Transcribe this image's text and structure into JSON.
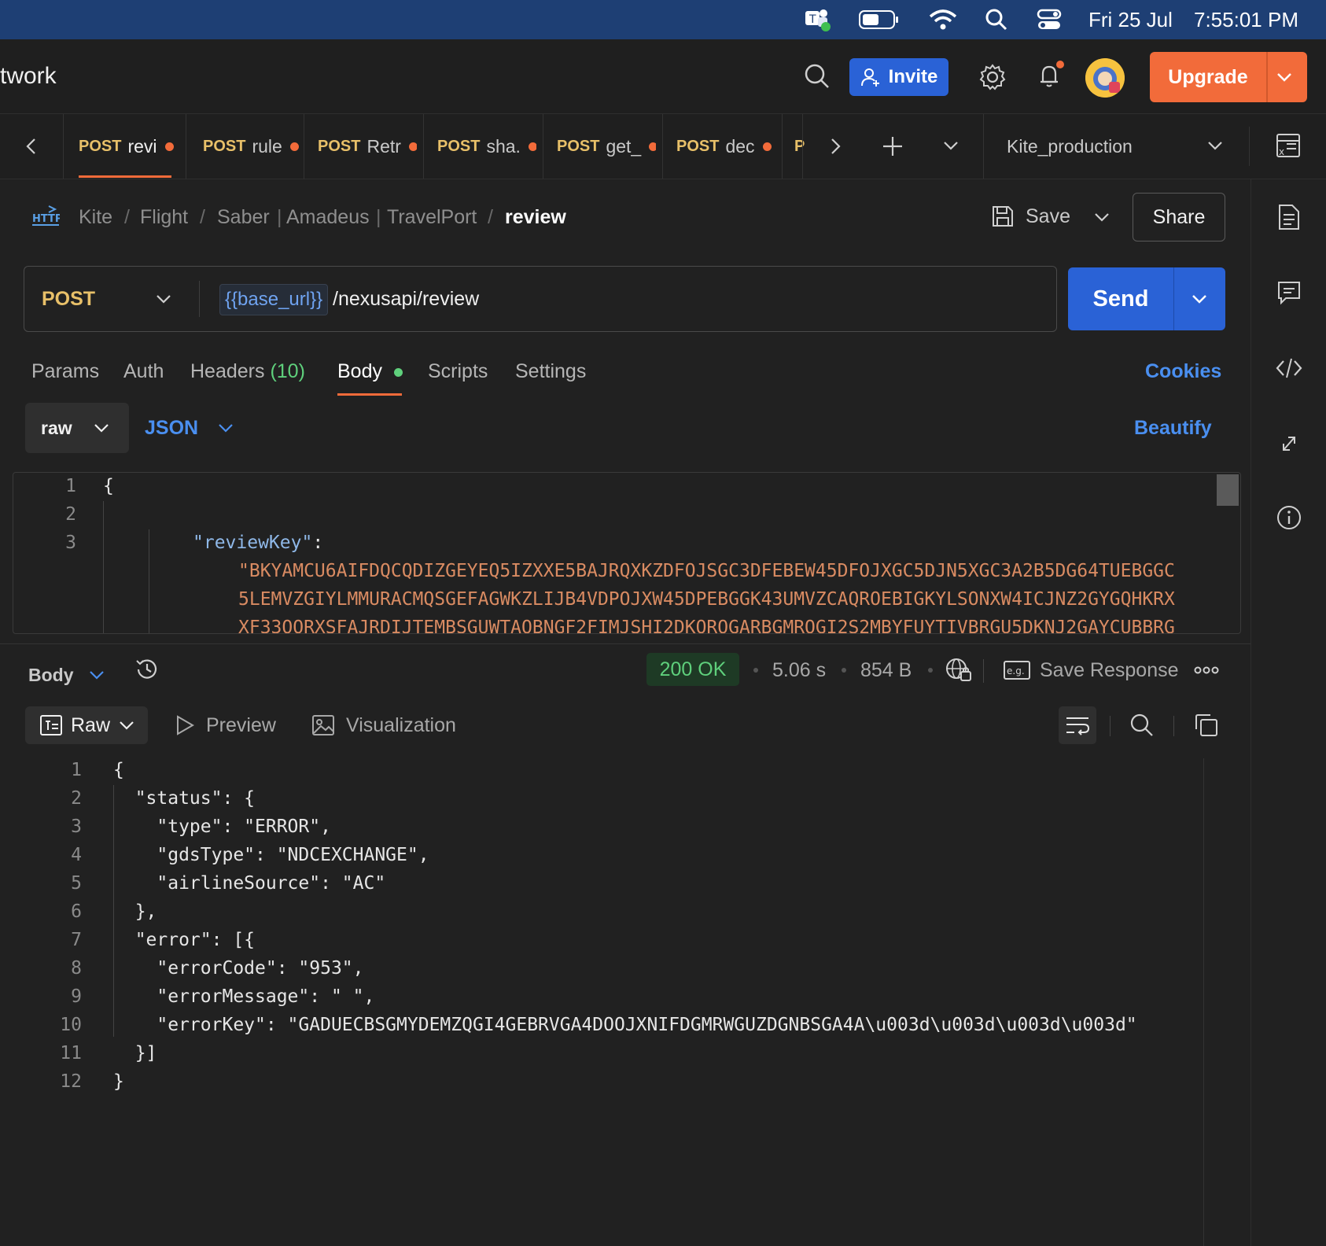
{
  "menubar": {
    "date": "Fri 25 Jul",
    "time": "7:55:01 PM"
  },
  "header": {
    "workspace_title": "twork",
    "invite_label": "Invite",
    "upgrade_label": "Upgrade"
  },
  "tabs": [
    {
      "method": "POST",
      "name": "revi"
    },
    {
      "method": "POST",
      "name": "rule"
    },
    {
      "method": "POST",
      "name": "Retr"
    },
    {
      "method": "POST",
      "name": "sha."
    },
    {
      "method": "POST",
      "name": "get_"
    },
    {
      "method": "POST",
      "name": "dec"
    },
    {
      "method": "P",
      "name": ""
    }
  ],
  "environment": "Kite_production",
  "breadcrumb": {
    "badge": "HTTP",
    "items": [
      "Kite",
      "/",
      "Flight",
      "/",
      "Saber",
      "|",
      "Amadeus",
      "|",
      "TravelPort",
      "/"
    ],
    "current": "review"
  },
  "actions": {
    "save_label": "Save",
    "share_label": "Share"
  },
  "request": {
    "method": "POST",
    "url_variable": "{{base_url}}",
    "url_path": "/nexusapi/review",
    "send_label": "Send"
  },
  "request_tabs": {
    "params": "Params",
    "auth": "Auth",
    "headers": "Headers",
    "headers_count": "(10)",
    "body": "Body",
    "scripts": "Scripts",
    "settings": "Settings",
    "cookies": "Cookies"
  },
  "body_toolbar": {
    "mode": "raw",
    "format": "JSON",
    "beautify": "Beautify"
  },
  "request_body": {
    "line_numbers": [
      "1",
      "2",
      "3"
    ],
    "line1": "{",
    "key": "\"reviewKey\"",
    "colon": ":",
    "value_lines": [
      "\"BKYAMCU6AIFDQCQDIZGEYEQ5IZXXE5BAJRQXKZDFOJSGC3DFEBEW45DFOJXGC5DJN5XGC3A2B5DG64TUEBGGC",
      "5LEMVZGIYLMMURACMQSGEFAGWKZLIJB4VDPOJXW45DPEBGGK43UMVZCAQROEBIGKYLSONXW4ICJNZ2GYGQHKRX",
      "XF33OORXSFAJRDIJTEMBSGUWTAOBNGF2FIMJSHI2DKOROGARBGMROGI2S2MBYFUYTIVBRGU5DKNJ2GAYCUBBRG"
    ]
  },
  "response": {
    "body_label": "Body",
    "status": "200 OK",
    "time": "5.06 s",
    "size": "854 B",
    "save_response": "Save Response",
    "view_raw": "Raw",
    "view_preview": "Preview",
    "view_visualization": "Visualization",
    "line_numbers": [
      "1",
      "2",
      "3",
      "4",
      "5",
      "6",
      "7",
      "8",
      "9",
      "10",
      "11",
      "12"
    ],
    "lines": [
      "{",
      "  \"status\": {",
      "    \"type\": \"ERROR\",",
      "    \"gdsType\": \"NDCEXCHANGE\",",
      "    \"airlineSource\": \"AC\"",
      "  },",
      "  \"error\": [{",
      "    \"errorCode\": \"953\",",
      "    \"errorMessage\": \" \",",
      "    \"errorKey\": \"GADUECBSGMYDEMZQGI4GEBRVGA4DOOJXNIFDGMRWGUZDGNBSGA4A\\u003d\\u003d\\u003d\\u003d\"",
      "  }]",
      "}"
    ]
  },
  "colors": {
    "accent": "#f26b3a",
    "primary": "#2a62d6",
    "method": "#e8c069",
    "link": "#4a8ff0",
    "success": "#5fd07c"
  }
}
